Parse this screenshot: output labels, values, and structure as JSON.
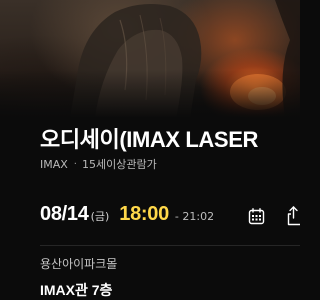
{
  "movie": {
    "title": "오디세이(IMAX LASER",
    "format": "IMAX",
    "rating": "15세이상관람가"
  },
  "showtime": {
    "date": "08/14",
    "weekday": "(금)",
    "start": "18:00",
    "end": "- 21:02"
  },
  "venue": {
    "cinema": "용산아이파크몰",
    "screen": "IMAX관 7층"
  },
  "icons": {
    "calendar": "calendar-icon",
    "share": "share-icon"
  },
  "colors": {
    "background": "#0b0b0b",
    "accent_time": "#ffd84a",
    "text_primary": "#ffffff",
    "text_secondary": "#b8b8b8"
  }
}
